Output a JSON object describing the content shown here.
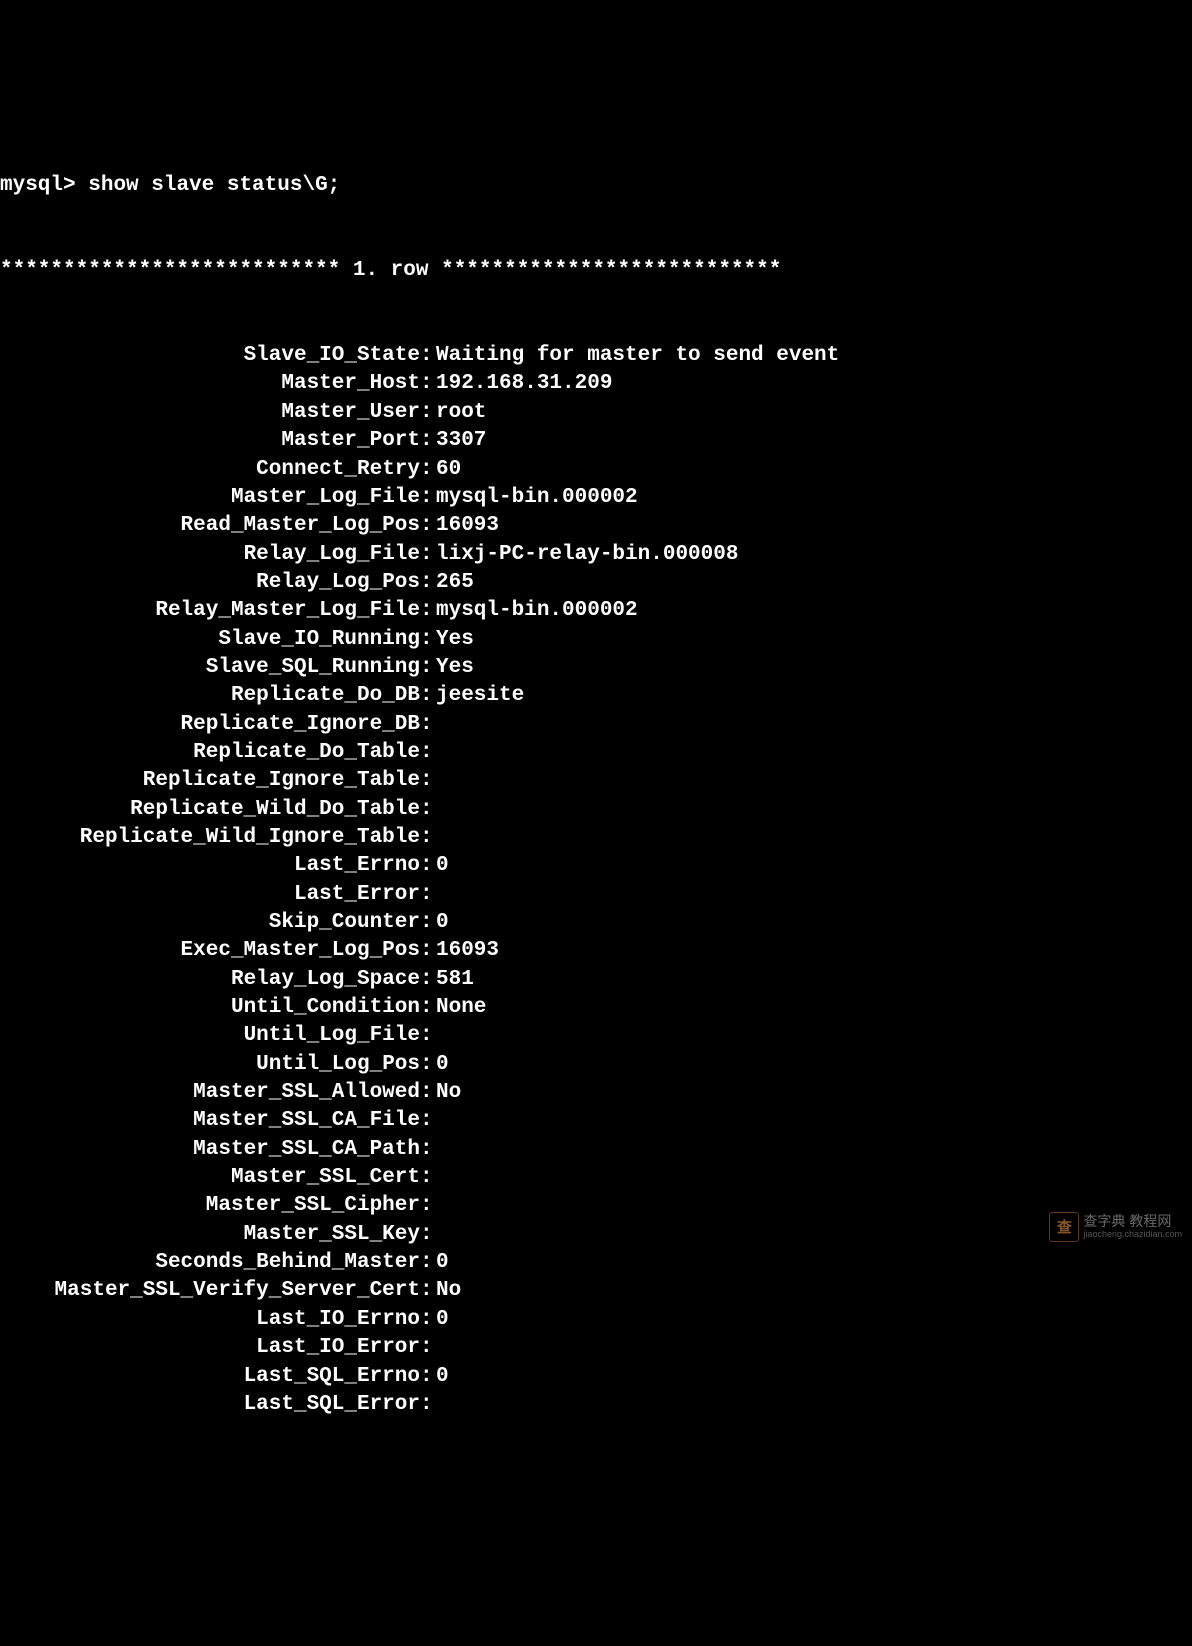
{
  "prompt": "mysql>",
  "command": "show slave status\\G;",
  "row_header_prefix": "***************************",
  "row_header_mid": " 1. row ",
  "row_header_suffix": "***************************",
  "fields": [
    {
      "label": "Slave_IO_State",
      "value": "Waiting for master to send event"
    },
    {
      "label": "Master_Host",
      "value": "192.168.31.209"
    },
    {
      "label": "Master_User",
      "value": "root"
    },
    {
      "label": "Master_Port",
      "value": "3307"
    },
    {
      "label": "Connect_Retry",
      "value": "60"
    },
    {
      "label": "Master_Log_File",
      "value": "mysql-bin.000002"
    },
    {
      "label": "Read_Master_Log_Pos",
      "value": "16093"
    },
    {
      "label": "Relay_Log_File",
      "value": "lixj-PC-relay-bin.000008"
    },
    {
      "label": "Relay_Log_Pos",
      "value": "265"
    },
    {
      "label": "Relay_Master_Log_File",
      "value": "mysql-bin.000002"
    },
    {
      "label": "Slave_IO_Running",
      "value": "Yes"
    },
    {
      "label": "Slave_SQL_Running",
      "value": "Yes"
    },
    {
      "label": "Replicate_Do_DB",
      "value": "jeesite"
    },
    {
      "label": "Replicate_Ignore_DB",
      "value": ""
    },
    {
      "label": "Replicate_Do_Table",
      "value": ""
    },
    {
      "label": "Replicate_Ignore_Table",
      "value": ""
    },
    {
      "label": "Replicate_Wild_Do_Table",
      "value": ""
    },
    {
      "label": "Replicate_Wild_Ignore_Table",
      "value": ""
    },
    {
      "label": "Last_Errno",
      "value": "0"
    },
    {
      "label": "Last_Error",
      "value": ""
    },
    {
      "label": "Skip_Counter",
      "value": "0"
    },
    {
      "label": "Exec_Master_Log_Pos",
      "value": "16093"
    },
    {
      "label": "Relay_Log_Space",
      "value": "581"
    },
    {
      "label": "Until_Condition",
      "value": "None"
    },
    {
      "label": "Until_Log_File",
      "value": ""
    },
    {
      "label": "Until_Log_Pos",
      "value": "0"
    },
    {
      "label": "Master_SSL_Allowed",
      "value": "No"
    },
    {
      "label": "Master_SSL_CA_File",
      "value": ""
    },
    {
      "label": "Master_SSL_CA_Path",
      "value": ""
    },
    {
      "label": "Master_SSL_Cert",
      "value": ""
    },
    {
      "label": "Master_SSL_Cipher",
      "value": ""
    },
    {
      "label": "Master_SSL_Key",
      "value": ""
    },
    {
      "label": "Seconds_Behind_Master",
      "value": "0"
    },
    {
      "label": "Master_SSL_Verify_Server_Cert",
      "value": "No"
    },
    {
      "label": "Last_IO_Errno",
      "value": "0"
    },
    {
      "label": "Last_IO_Error",
      "value": ""
    },
    {
      "label": "Last_SQL_Errno",
      "value": "0"
    },
    {
      "label": "Last_SQL_Error",
      "value": ""
    }
  ],
  "watermark": {
    "logo": "查",
    "main": "查字典 教程网",
    "sub": "jiaocheng.chazidian.com"
  }
}
